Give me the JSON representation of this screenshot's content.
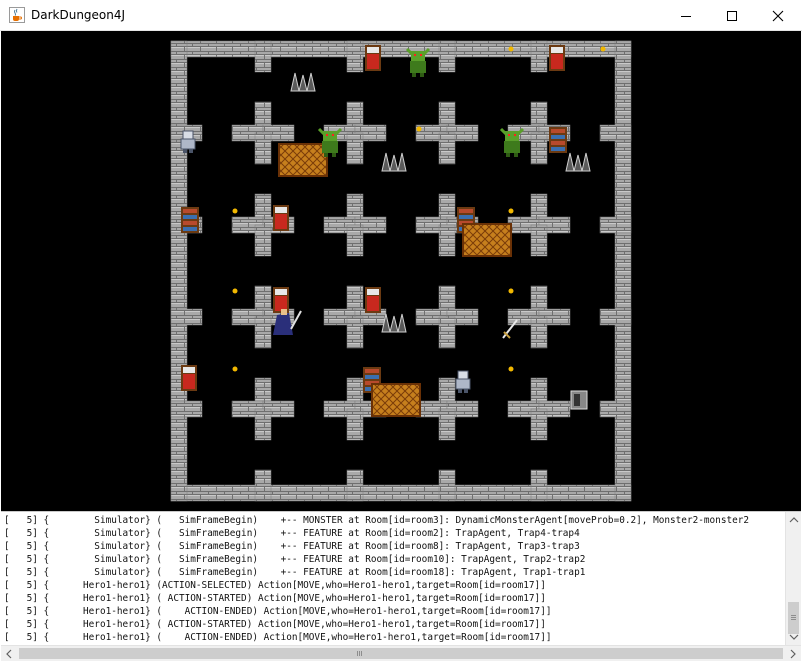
{
  "window": {
    "title": "DarkDungeon4J",
    "icons": [
      "java-cup-icon",
      "minimize-icon",
      "maximize-icon",
      "close-icon"
    ]
  },
  "game": {
    "palette": {
      "background": "#000000",
      "wall": "#a8a8a8",
      "wall_dark": "#7c7c7c",
      "torch": "#f2b800",
      "carpet": "#c8831c",
      "monster_green": "#5aa02a",
      "bed_red": "#c8281e"
    },
    "rooms_grid": {
      "columns": 5,
      "rows": 5
    },
    "entities": [
      "goblin-monster",
      "goblin-monster",
      "goblin-monster",
      "knight-armor",
      "knight-armor",
      "hero",
      "sword-item",
      "stairs"
    ],
    "features": [
      "bed",
      "bookshelf",
      "carpet",
      "spike-trap",
      "torch"
    ]
  },
  "log": {
    "lines": [
      "[   5] {        Simulator} (   SimFrameBegin)    +-- MONSTER at Room[id=room3]: DynamicMonsterAgent[moveProb=0.2], Monster2-monster2",
      "[   5] {        Simulator} (   SimFrameBegin)    +-- FEATURE at Room[id=room2]: TrapAgent, Trap4-trap4",
      "[   5] {        Simulator} (   SimFrameBegin)    +-- FEATURE at Room[id=room8]: TrapAgent, Trap3-trap3",
      "[   5] {        Simulator} (   SimFrameBegin)    +-- FEATURE at Room[id=room10]: TrapAgent, Trap2-trap2",
      "[   5] {        Simulator} (   SimFrameBegin)    +-- FEATURE at Room[id=room18]: TrapAgent, Trap1-trap1",
      "[   5] {      Hero1-hero1} (ACTION-SELECTED) Action[MOVE,who=Hero1-hero1,target=Room[id=room17]]",
      "[   5] {      Hero1-hero1} ( ACTION-STARTED) Action[MOVE,who=Hero1-hero1,target=Room[id=room17]]",
      "[   5] {      Hero1-hero1} (    ACTION-ENDED) Action[MOVE,who=Hero1-hero1,target=Room[id=room17]]",
      "[   5] {      Hero1-hero1} ( ACTION-STARTED) Action[MOVE,who=Hero1-hero1,target=Room[id=room17]]",
      "[   5] {      Hero1-hero1} (    ACTION-ENDED) Action[MOVE,who=Hero1-hero1,target=Room[id=room17]]"
    ]
  }
}
